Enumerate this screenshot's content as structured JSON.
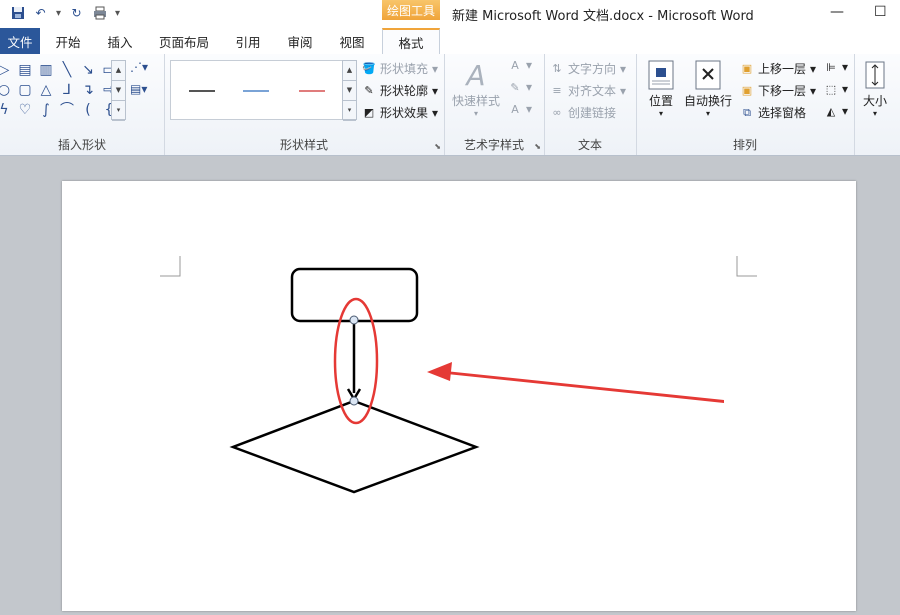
{
  "qat": {
    "items": [
      "save-icon",
      "undo-icon",
      "redo-icon",
      "print-icon",
      "customize-icon"
    ]
  },
  "context_tab_label": "绘图工具",
  "window_title": "新建 Microsoft Word 文档.docx - Microsoft Word",
  "window_controls": {
    "minimize": "—",
    "maximize": "☐"
  },
  "tabs": {
    "file": "文件",
    "home": "开始",
    "insert": "插入",
    "layout": "页面布局",
    "references": "引用",
    "review": "审阅",
    "view": "视图",
    "format": "格式"
  },
  "groups": {
    "insert_shapes": {
      "label": "插入形状"
    },
    "shape_styles": {
      "label": "形状样式",
      "fill": "形状填充",
      "outline": "形状轮廓",
      "effects": "形状效果"
    },
    "wordart": {
      "label": "艺术字样式",
      "quick_styles": "快速样式"
    },
    "text": {
      "label": "文本",
      "direction": "文字方向",
      "align": "对齐文本",
      "link": "创建链接"
    },
    "arrange": {
      "label": "排列",
      "position": "位置",
      "wrap": "自动换行",
      "bring_forward": "上移一层",
      "send_backward": "下移一层",
      "selection_pane": "选择窗格"
    },
    "size": {
      "label": "大小"
    }
  },
  "style_colors": [
    "#555555",
    "#7aa3d6",
    "#e07c7c"
  ],
  "annotation_color": "#e53935"
}
